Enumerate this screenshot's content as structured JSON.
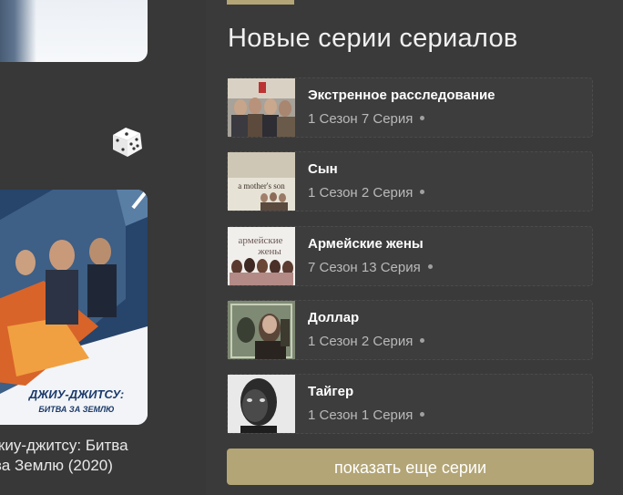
{
  "section": {
    "title": "Новые серии сериалов"
  },
  "episodes": [
    {
      "show": "Экстренное расследование",
      "info": "1 Сезон 7 Серия"
    },
    {
      "show": "Сын",
      "info": "1 Сезон 2 Серия",
      "thumb_text": "a mother's son"
    },
    {
      "show": "Армейские жены",
      "info": "7 Сезон 13 Серия",
      "thumb_text_1": "армейские",
      "thumb_text_2": "жены"
    },
    {
      "show": "Доллар",
      "info": "1 Сезон 2 Серия"
    },
    {
      "show": "Тайгер",
      "info": "1 Сезон 1 Серия"
    }
  ],
  "more_button": "показать еще серии",
  "left_poster": {
    "title": "жиу-джитсу: Битва за Землю (2020)",
    "title_line1": "жиу-джитсу: Битва",
    "title_line2": "за Землю (2020)",
    "art_line1": "ДЖИУ-ДЖИТСУ:",
    "art_line2": "БИТВА ЗА ЗЕМЛЮ"
  },
  "colors": {
    "accent": "#b3a575",
    "bg_left": "#383838",
    "bg_right": "#3a3a3a"
  },
  "icons": {
    "random": "dice-icon"
  }
}
